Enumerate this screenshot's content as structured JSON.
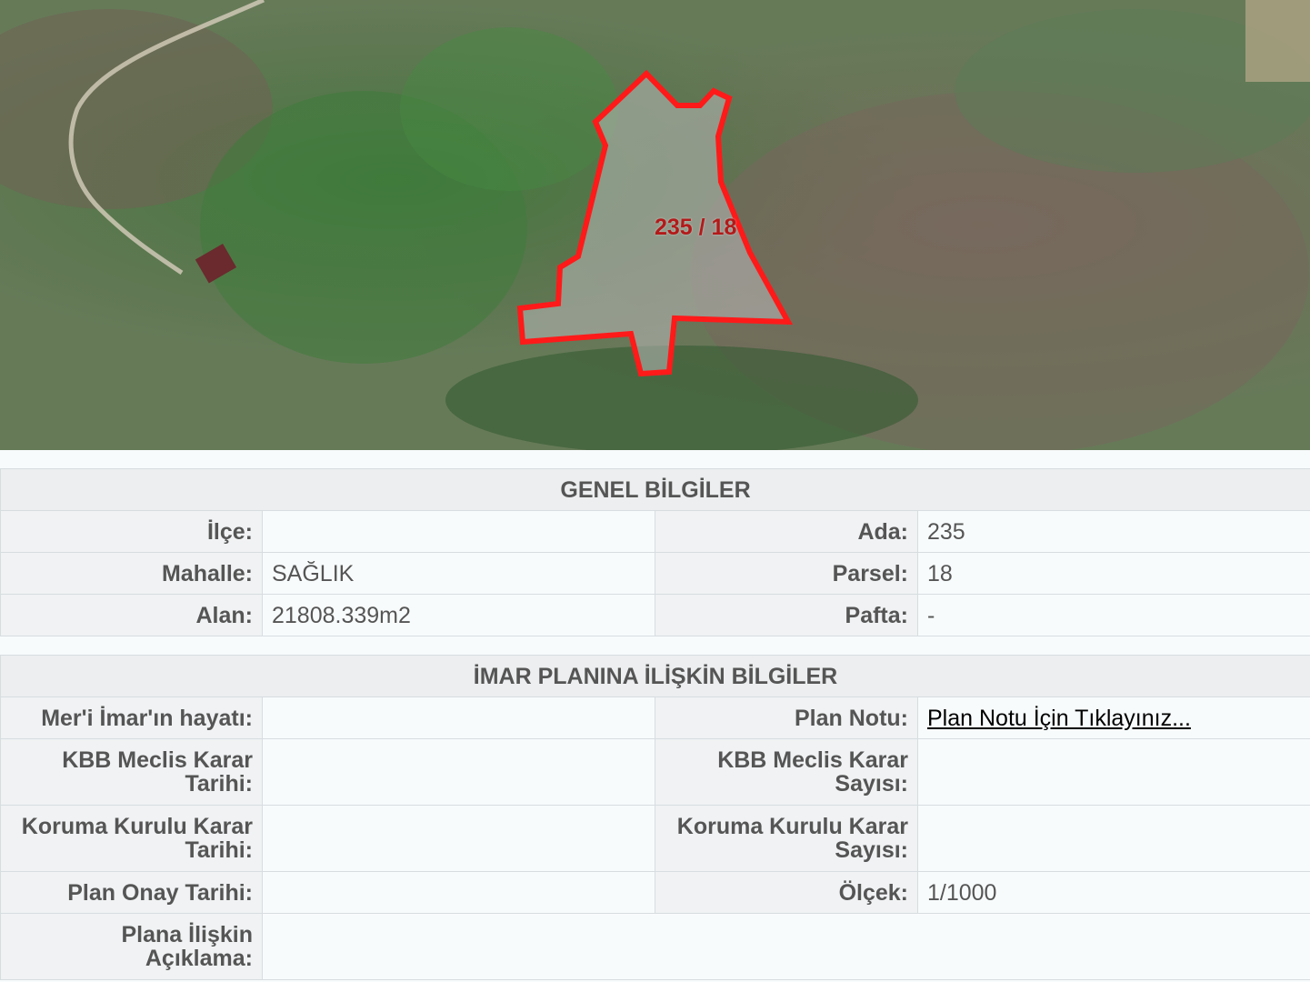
{
  "map": {
    "parcel_label": "235 / 18",
    "outline_color": "#ff1a1a"
  },
  "genel": {
    "title": "GENEL BİLGİLER",
    "rows": [
      {
        "label_l": "İlçe:",
        "value_l": "",
        "label_r": "Ada:",
        "value_r": "235"
      },
      {
        "label_l": "Mahalle:",
        "value_l": "SAĞLIK",
        "label_r": "Parsel:",
        "value_r": "18"
      },
      {
        "label_l": "Alan:",
        "value_l": "21808.339m2",
        "label_r": "Pafta:",
        "value_r": "-"
      }
    ]
  },
  "imar": {
    "title": "İMAR PLANINA İLİŞKİN BİLGİLER",
    "meri_label": "Mer'i İmar'ın hayatı:",
    "meri_value": "",
    "plan_notu_label": "Plan Notu:",
    "plan_notu_link": "Plan Notu İçin Tıklayınız...",
    "kbb_tarih_label": "KBB Meclis Karar Tarihi:",
    "kbb_tarih_value": "",
    "kbb_sayi_label": "KBB Meclis Karar Sayısı:",
    "kbb_sayi_value": "",
    "koruma_tarih_label": "Koruma Kurulu Karar Tarihi:",
    "koruma_tarih_value": "",
    "koruma_sayi_label": "Koruma Kurulu Karar Sayısı:",
    "koruma_sayi_value": "",
    "onay_label": "Plan Onay Tarihi:",
    "onay_value": "",
    "olcek_label": "Ölçek:",
    "olcek_value": "1/1000",
    "aciklama_label": "Plana İlişkin Açıklama:",
    "aciklama_value": ""
  }
}
